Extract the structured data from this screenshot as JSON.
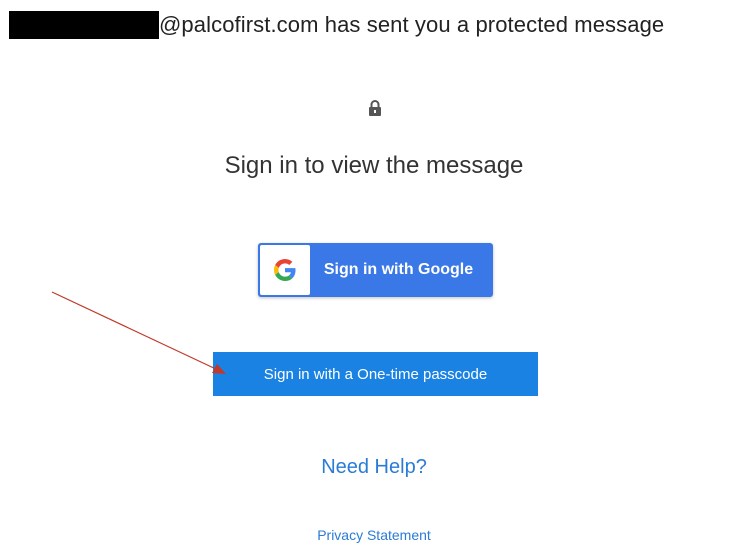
{
  "header": {
    "sender_text": "@palcofirst.com has sent you a protected message"
  },
  "icons": {
    "lock": "lock-icon",
    "google": "google-logo-icon"
  },
  "main": {
    "title": "Sign in to view the message",
    "google_button_label": "Sign in with Google",
    "otp_button_label": "Sign in with a One-time passcode",
    "help_link": "Need Help?",
    "privacy_link": "Privacy Statement"
  },
  "colors": {
    "google_button": "#3b78e7",
    "otp_button": "#1a82e2",
    "link": "#2b7bd6",
    "arrow": "#c0392b"
  }
}
